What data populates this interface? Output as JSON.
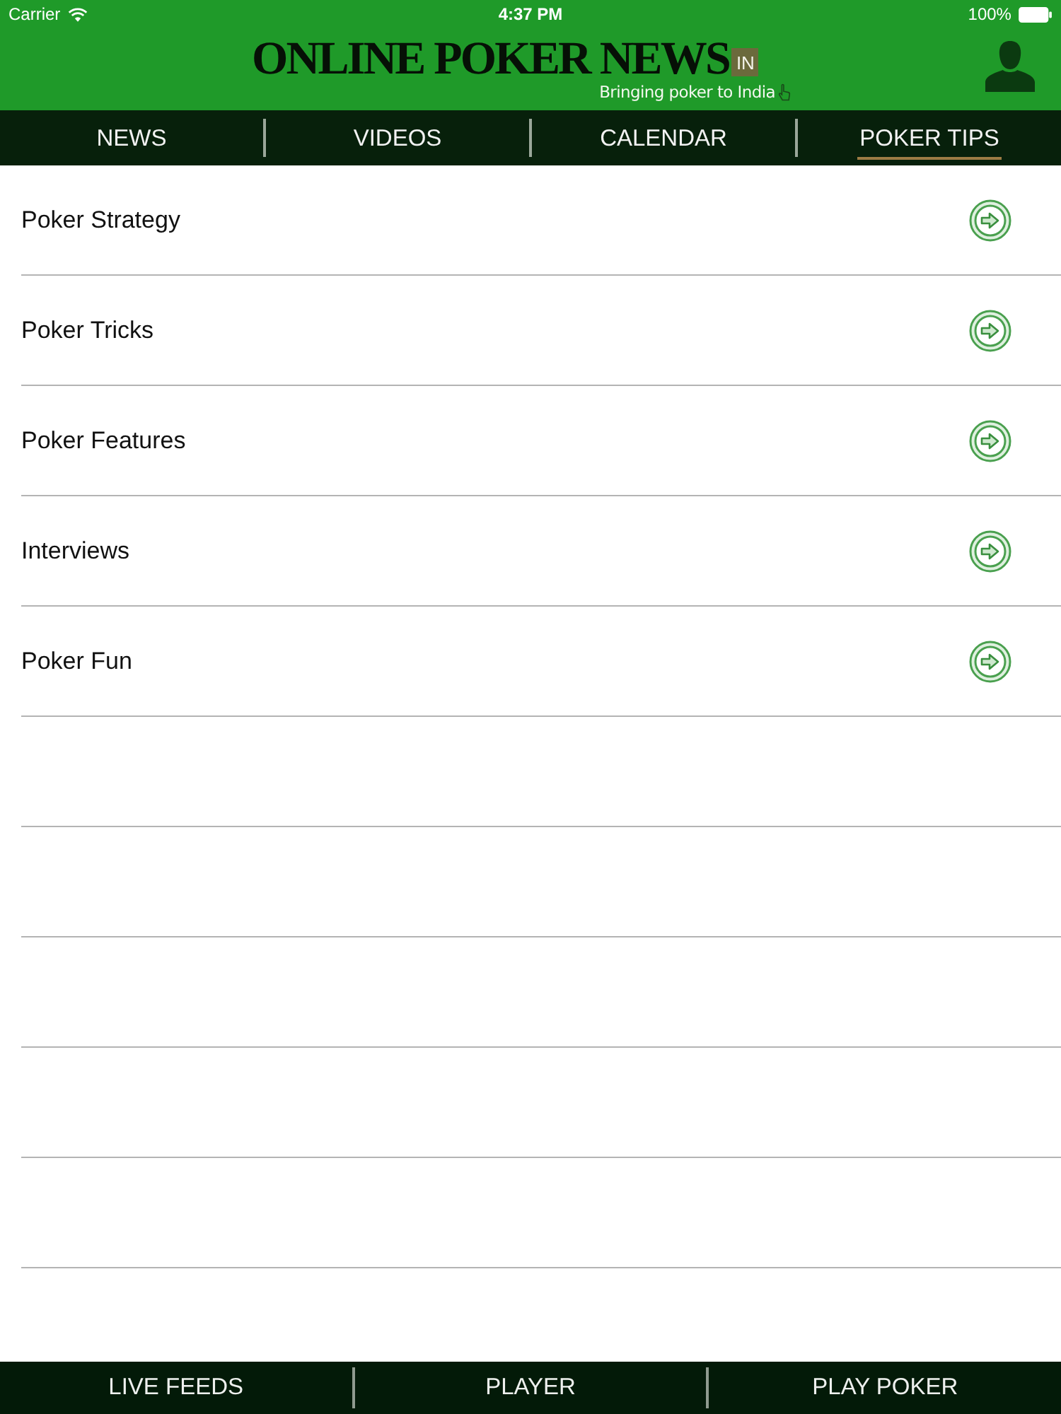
{
  "status_bar": {
    "carrier": "Carrier",
    "time": "4:37 PM",
    "battery": "100%"
  },
  "header": {
    "logo": "ONLINE POKER NEWS",
    "logo_badge": "IN",
    "tagline": "Bringing poker to India"
  },
  "tabs": [
    {
      "label": "NEWS",
      "selected": false
    },
    {
      "label": "VIDEOS",
      "selected": false
    },
    {
      "label": "CALENDAR",
      "selected": false
    },
    {
      "label": "POKER TIPS",
      "selected": true
    }
  ],
  "list": {
    "items": [
      {
        "label": "Poker Strategy"
      },
      {
        "label": "Poker Tricks"
      },
      {
        "label": "Poker Features"
      },
      {
        "label": "Interviews"
      },
      {
        "label": "Poker Fun"
      }
    ]
  },
  "bottom_bar": {
    "items": [
      "LIVE FEEDS",
      "PLAYER",
      "PLAY POKER"
    ]
  }
}
